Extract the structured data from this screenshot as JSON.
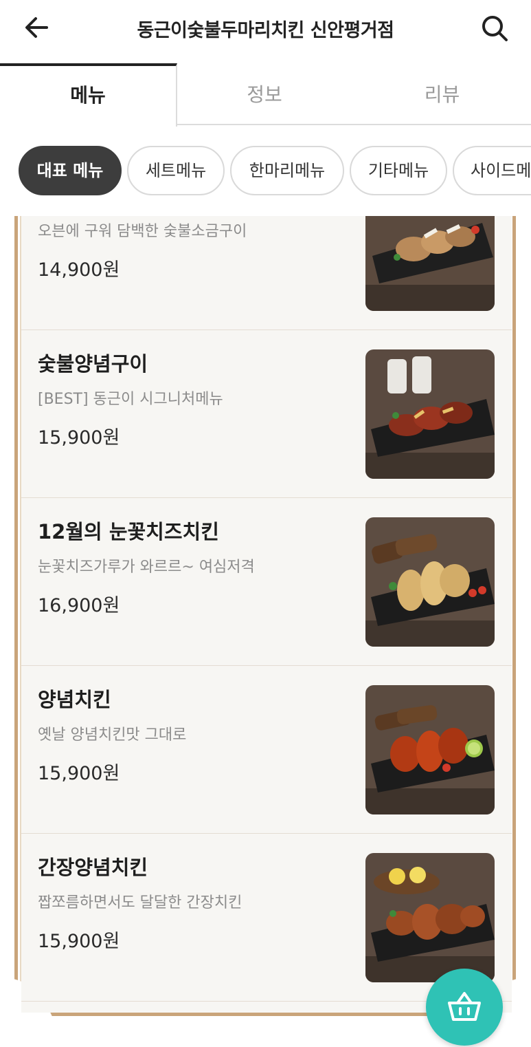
{
  "header": {
    "title": "동근이숯불두마리치킨 신안평거점",
    "back_icon": "arrow-left-icon",
    "search_icon": "search-icon"
  },
  "tabs": [
    {
      "label": "메뉴",
      "active": true
    },
    {
      "label": "정보",
      "active": false
    },
    {
      "label": "리뷰",
      "active": false
    }
  ],
  "categories": [
    {
      "label": "대표 메뉴",
      "selected": true
    },
    {
      "label": "세트메뉴",
      "selected": false
    },
    {
      "label": "한마리메뉴",
      "selected": false
    },
    {
      "label": "기타메뉴",
      "selected": false
    },
    {
      "label": "사이드메",
      "selected": false
    }
  ],
  "menu_items": [
    {
      "name": "",
      "description": "오븐에 구워 담백한 숯불소금구이",
      "price": "14,900원"
    },
    {
      "name": "숯불양념구이",
      "description": "[BEST] 동근이 시그니처메뉴",
      "price": "15,900원"
    },
    {
      "name": "12월의 눈꽃치즈치킨",
      "description": "눈꽃치즈가루가 와르르~ 여심저격",
      "price": "16,900원"
    },
    {
      "name": "양념치킨",
      "description": "옛날 양념치킨맛 그대로",
      "price": "15,900원"
    },
    {
      "name": "간장양념치킨",
      "description": "짭쪼름하면서도 달달한 간장치킨",
      "price": "15,900원"
    }
  ],
  "cart": {
    "icon": "shopping-basket-icon"
  },
  "colors": {
    "accent": "#2fc2b5",
    "chip_selected": "#3d3d3d",
    "board_frame": "#c9a47a",
    "board_paper": "#f7f6f3"
  }
}
